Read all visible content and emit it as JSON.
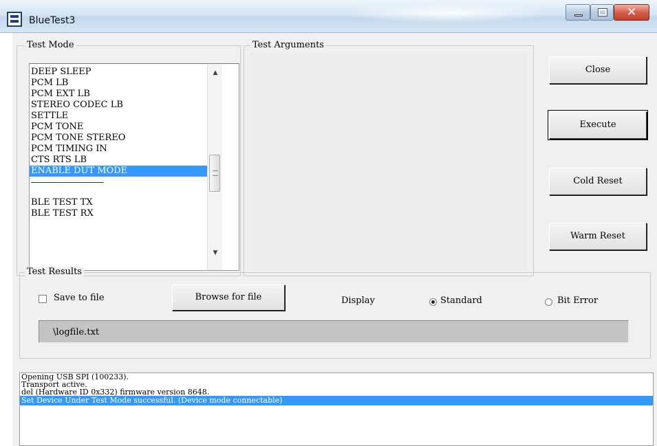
{
  "window": {
    "title": "BlueTest3",
    "buttons": {
      "minimize": "minimize",
      "maximize": "maximize",
      "close": "✕"
    }
  },
  "test_mode": {
    "label": "Test Mode",
    "items": [
      {
        "label": "DEEP SLEEP",
        "selected": false
      },
      {
        "label": "PCM LB",
        "selected": false
      },
      {
        "label": "PCM EXT LB",
        "selected": false
      },
      {
        "label": "STEREO CODEC LB",
        "selected": false
      },
      {
        "label": "SETTLE",
        "selected": false
      },
      {
        "label": "PCM TONE",
        "selected": false
      },
      {
        "label": "PCM TONE STEREO",
        "selected": false
      },
      {
        "label": "PCM TIMING IN",
        "selected": false
      },
      {
        "label": "CTS RTS LB",
        "selected": false
      },
      {
        "label": "ENABLE DUT MODE",
        "selected": true
      },
      {
        "label": "",
        "separator": true
      },
      {
        "label": "BLE TEST TX",
        "selected": false
      },
      {
        "label": "BLE TEST RX",
        "selected": false
      }
    ]
  },
  "test_arguments": {
    "label": "Test Arguments"
  },
  "actions": {
    "close": "Close",
    "execute": "Execute",
    "cold_reset": "Cold Reset",
    "warm_reset": "Warm Reset"
  },
  "test_results": {
    "label": "Test Results",
    "save_to_file": {
      "label": "Save to file",
      "checked": false
    },
    "browse_button": "Browse for file",
    "display_label": "Display",
    "standard": {
      "label": "Standard",
      "checked": true
    },
    "bit_error": {
      "label": "Bit Error",
      "checked": false
    },
    "file_path": "\\logfile.txt"
  },
  "log": {
    "lines": [
      {
        "text": "Opening USB SPI (100233).",
        "selected": false
      },
      {
        "text": "Transport active.",
        "selected": false
      },
      {
        "text": "del (Hardware ID 0x332) firmware version 8648.",
        "selected": false
      },
      {
        "text": "Set Device Under Test Mode successful. (Device mode connectable)",
        "selected": true
      }
    ]
  },
  "colors": {
    "selection": "#3399ff",
    "dialog_bg": "#f0f0f0"
  },
  "icons": [
    "app-icon",
    "scroll-up-icon",
    "scroll-down-icon"
  ]
}
